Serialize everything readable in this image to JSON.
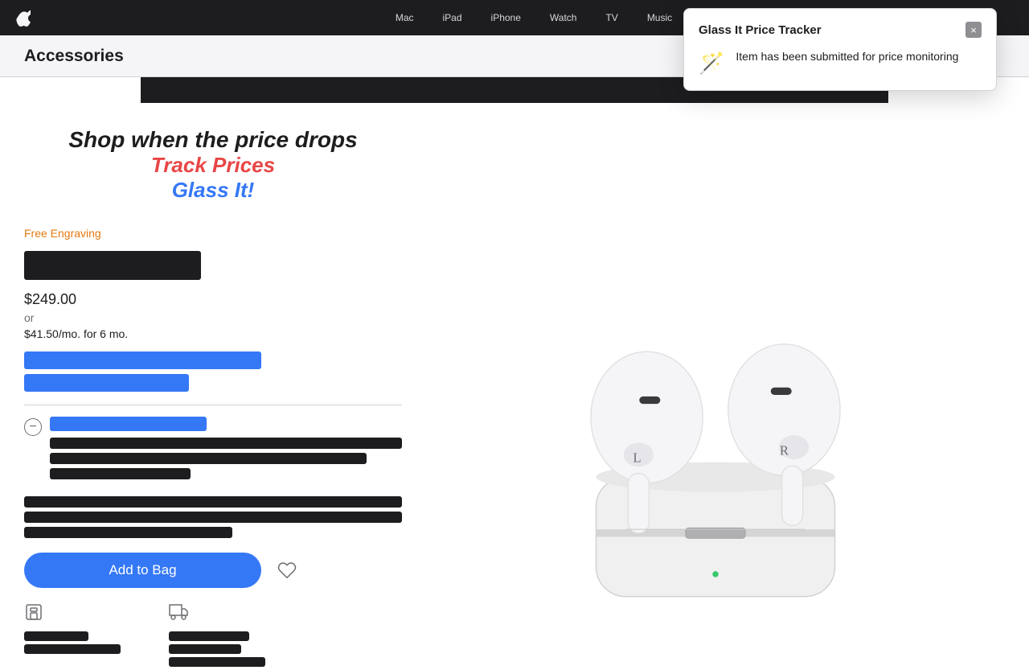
{
  "nav": {
    "logo_label": "Apple",
    "items": [
      {
        "label": "Mac",
        "id": "mac"
      },
      {
        "label": "iPad",
        "id": "ipad"
      },
      {
        "label": "iPhone",
        "id": "iphone"
      },
      {
        "label": "Watch",
        "id": "watch"
      },
      {
        "label": "TV",
        "id": "tv"
      },
      {
        "label": "Music",
        "id": "music"
      }
    ]
  },
  "sub_nav": {
    "title": "Accessories"
  },
  "popup": {
    "title": "Glass It Price Tracker",
    "close_label": "×",
    "message": "Item has been submitted for price monitoring"
  },
  "promo": {
    "headline": "Shop when the price drops",
    "track": "Track Prices",
    "glass": "Glass It!"
  },
  "product": {
    "free_engraving": "Free Engraving",
    "price": "$249.00",
    "or": "or",
    "monthly": "$41.50/mo. for 6 mo.",
    "add_to_bag": "Add to Bag"
  }
}
